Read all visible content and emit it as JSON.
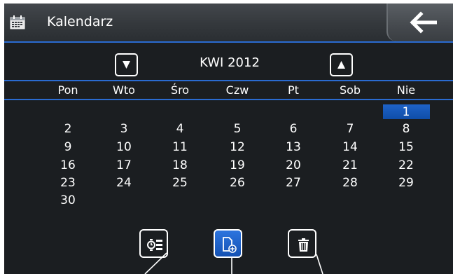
{
  "header": {
    "title": "Kalendarz"
  },
  "calendar": {
    "month_label": "KWI 2012",
    "weekdays": [
      "Pon",
      "Wto",
      "Śro",
      "Czw",
      "Pt",
      "Sob",
      "Nie"
    ],
    "selected_day": "1",
    "weeks": [
      [
        "",
        "",
        "",
        "",
        "",
        "",
        "1"
      ],
      [
        "2",
        "3",
        "4",
        "5",
        "6",
        "7",
        "8"
      ],
      [
        "9",
        "10",
        "11",
        "12",
        "13",
        "14",
        "15"
      ],
      [
        "16",
        "17",
        "18",
        "19",
        "20",
        "21",
        "22"
      ],
      [
        "23",
        "24",
        "25",
        "26",
        "27",
        "28",
        "29"
      ],
      [
        "30",
        "",
        "",
        "",
        "",
        "",
        ""
      ]
    ]
  },
  "toolbar": {
    "icons": [
      "agenda-list-icon",
      "new-event-icon",
      "trash-icon"
    ]
  },
  "colors": {
    "background": "#1b1e21",
    "accent": "#2a6bd1",
    "text": "#ffffff"
  }
}
